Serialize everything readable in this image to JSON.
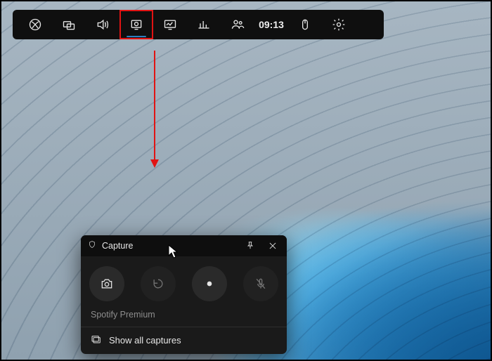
{
  "toolbar": {
    "time": "09:13",
    "icons": [
      {
        "name": "xbox-icon"
      },
      {
        "name": "widgets-icon"
      },
      {
        "name": "audio-icon"
      },
      {
        "name": "capture-icon"
      },
      {
        "name": "performance-icon"
      },
      {
        "name": "stats-icon"
      },
      {
        "name": "social-icon"
      },
      {
        "name": "mouse-icon"
      },
      {
        "name": "settings-icon"
      }
    ]
  },
  "capture_widget": {
    "title": "Capture",
    "context_app": "Spotify Premium",
    "footer_label": "Show all captures",
    "buttons": {
      "screenshot": "Take screenshot",
      "last30": "Record last 30 seconds",
      "record": "Start recording",
      "mic": "Microphone"
    }
  }
}
